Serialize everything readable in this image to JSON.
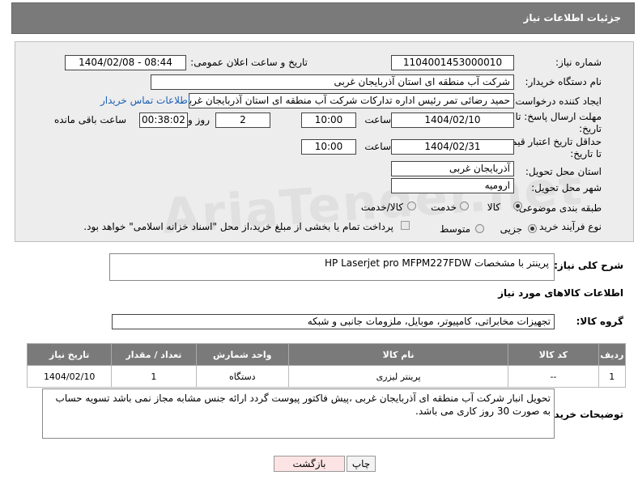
{
  "header": {
    "title": "جزئیات اطلاعات نیاز"
  },
  "form": {
    "need_number_label": "شماره نیاز:",
    "need_number": "1104001453000010",
    "announce_label": "تاریخ و ساعت اعلان عمومی:",
    "announce_value": "1404/02/08 - 08:44",
    "buyer_org_label": "نام دستگاه خریدار:",
    "buyer_org": "شرکت آب منطقه ای استان آذربایجان غربی",
    "creator_label": "ایجاد کننده درخواست:",
    "creator": "حمید رضائی تمر رئیس اداره تدارکات شرکت آب منطقه ای استان آذربایجان غربی",
    "contact_link": "اطلاعات تماس خریدار",
    "deadline_label": "مهلت ارسال پاسخ: تا تاریخ:",
    "deadline_date": "1404/02/10",
    "time_label": "ساعت",
    "deadline_time": "10:00",
    "days_value": "2",
    "days_label": "روز و",
    "remaining_time": "00:38:02",
    "remaining_label": "ساعت باقی مانده",
    "price_label": "حداقل تاریخ اعتبار قیمت: تا تاریخ:",
    "price_date": "1404/02/31",
    "price_time_label": "ساعت",
    "price_time": "10:00",
    "province_label": "استان محل تحویل:",
    "province": "آذربایجان غربی",
    "city_label": "شهر محل تحویل:",
    "city": "ارومیه",
    "category_label": "طبقه بندی موضوعی:",
    "cat_goods": "کالا",
    "cat_service": "خدمت",
    "cat_both": "کالا/خدمت",
    "process_label": "نوع فرآیند خرید :",
    "proc_partial": "جزیی",
    "proc_medium": "متوسط",
    "payment_note": "پرداخت تمام یا بخشی از مبلغ خرید،از محل \"اسناد خزانه اسلامی\" خواهد بود."
  },
  "description": {
    "label": "شرح کلی نیاز:",
    "value": "پرینتر با مشخصات HP Laserjet pro MFPM227FDW"
  },
  "goods_info_title": "اطلاعات کالاهای مورد نیاز",
  "goods_group": {
    "label": "گروه کالا:",
    "value": "تجهیزات مخابراتی، کامپیوتر، موبایل، ملزومات جانبی و شبکه"
  },
  "table": {
    "headers": [
      "ردیف",
      "کد کالا",
      "نام کالا",
      "واحد شمارش",
      "تعداد / مقدار",
      "تاریخ نیاز"
    ],
    "rows": [
      [
        "1",
        "--",
        "پرینتر لیزری",
        "دستگاه",
        "1",
        "1404/02/10"
      ]
    ]
  },
  "buyer_notes": {
    "label": "توضیحات خریدار:",
    "value": "تحویل انبار شرکت آب منطقه ای آذربایجان غربی ،پیش فاکتور پیوست گردد  ارائه جنس مشابه مجاز نمی باشد تسویه حساب به صورت 30 روز کاری می باشد."
  },
  "buttons": {
    "print": "چاپ",
    "back": "بازگشت"
  },
  "watermark": "AriaTender.net"
}
